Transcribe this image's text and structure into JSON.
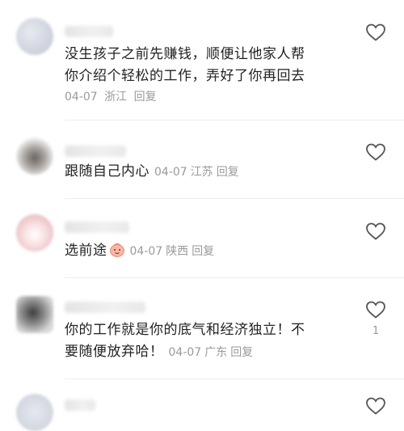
{
  "comments": [
    {
      "text_line1": "没生孩子之前先赚钱，顺便让他家人帮",
      "text_line2": "你介绍个轻松的工作，弄好了你再回去",
      "date": "04-07",
      "location": "浙江",
      "reply": "回复"
    },
    {
      "text": "跟随自己内心",
      "date": "04-07",
      "location": "江苏",
      "reply": "回复"
    },
    {
      "text": "选前途",
      "emoji": "smiling-face-emoji",
      "date": "04-07",
      "location": "陕西",
      "reply": "回复"
    },
    {
      "text_line1": "你的工作就是你的底气和经济独立！不",
      "text_line2": "要随便放弃哈！",
      "date": "04-07",
      "location": "广东",
      "reply": "回复",
      "likes": "1"
    }
  ],
  "icons": {
    "like": "heart-outline-icon"
  },
  "colors": {
    "text": "#222222",
    "meta": "#9a9a9a"
  }
}
